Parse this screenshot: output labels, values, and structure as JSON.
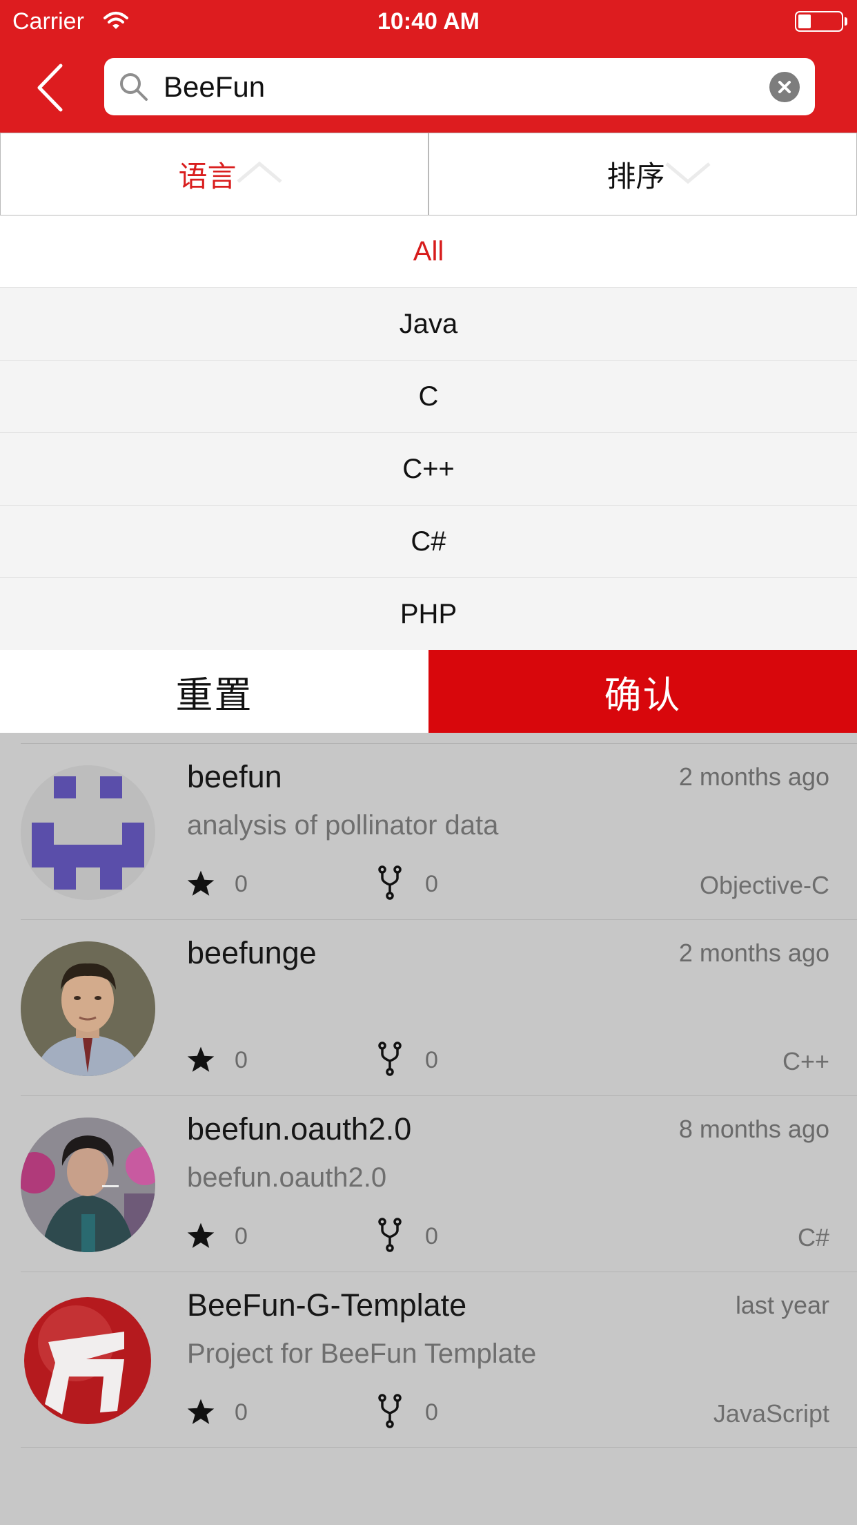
{
  "status_bar": {
    "carrier": "Carrier",
    "time": "10:40 AM",
    "battery_level": 0.3
  },
  "search": {
    "value": "BeeFun",
    "placeholder": ""
  },
  "filters": {
    "language_tab": "语言",
    "sort_tab": "排序"
  },
  "language_options": [
    {
      "label": "All",
      "selected": true
    },
    {
      "label": "Java",
      "selected": false
    },
    {
      "label": "C",
      "selected": false
    },
    {
      "label": "C++",
      "selected": false
    },
    {
      "label": "C#",
      "selected": false
    },
    {
      "label": "PHP",
      "selected": false
    }
  ],
  "actions": {
    "reset": "重置",
    "confirm": "确认"
  },
  "repos": [
    {
      "name": "beefun",
      "time": "2 months ago",
      "description": "analysis of pollinator data",
      "stars": "0",
      "forks": "0",
      "language": "Objective-C",
      "avatar": "identicon"
    },
    {
      "name": "beefunge",
      "time": "2 months ago",
      "description": "",
      "stars": "0",
      "forks": "0",
      "language": "C++",
      "avatar": "portrait"
    },
    {
      "name": "beefun.oauth2.0",
      "time": "8 months ago",
      "description": "beefun.oauth2.0",
      "stars": "0",
      "forks": "0",
      "language": "C#",
      "avatar": "street-photo"
    },
    {
      "name": "BeeFun-G-Template",
      "time": "last year",
      "description": "Project for BeeFun Template",
      "stars": "0",
      "forks": "0",
      "language": "JavaScript",
      "avatar": "red-logo"
    }
  ],
  "colors": {
    "brand_red": "#dd1c1f",
    "confirm_red": "#d8070c",
    "selected_text": "#d71c1c",
    "overlay": "#c7c7c7"
  }
}
